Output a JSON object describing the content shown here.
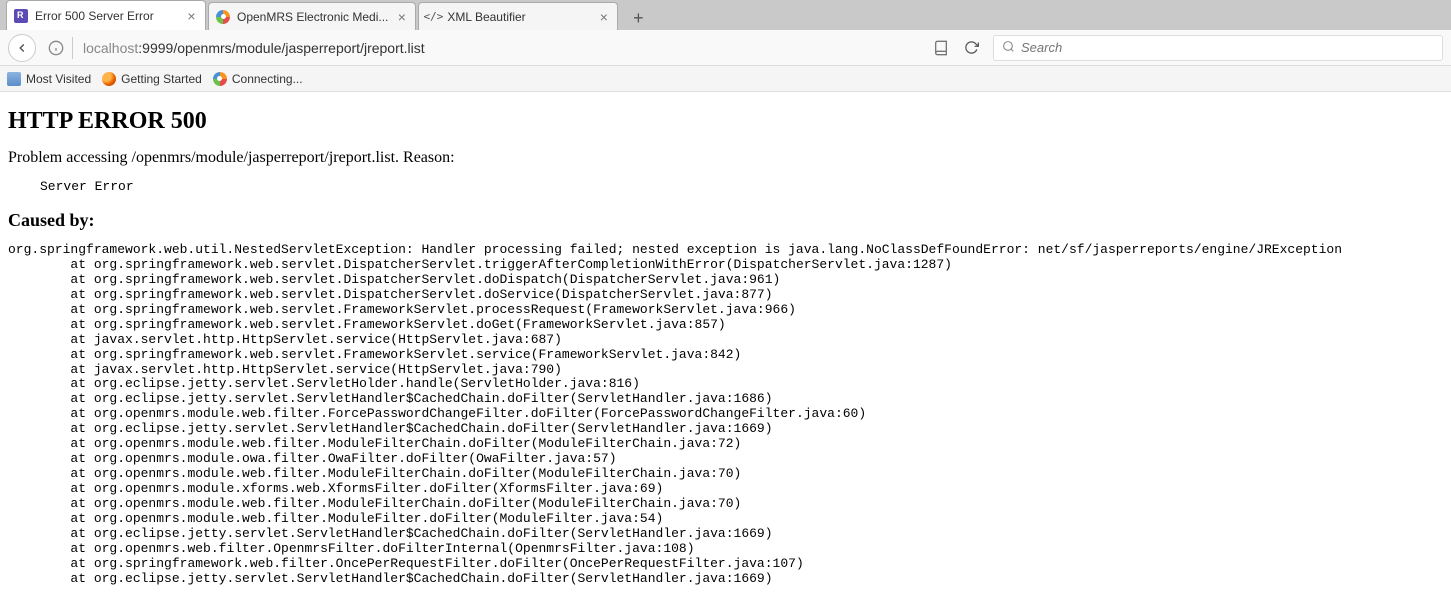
{
  "tabs": [
    {
      "title": "Error 500 Server Error",
      "active": true,
      "favicon": "jr"
    },
    {
      "title": "OpenMRS Electronic Medi...",
      "active": false,
      "favicon": "openmrs"
    },
    {
      "title": "XML Beautifier",
      "active": false,
      "favicon": "xml"
    }
  ],
  "url": {
    "hostPrefix": "localhost",
    "port": ":9999",
    "path": "/openmrs/module/jasperreport/jreport.list"
  },
  "search": {
    "placeholder": "Search"
  },
  "bookmarks": [
    {
      "label": "Most Visited",
      "icon": "most"
    },
    {
      "label": "Getting Started",
      "icon": "moz"
    },
    {
      "label": "Connecting...",
      "icon": "openmrs"
    }
  ],
  "error": {
    "heading": "HTTP ERROR 500",
    "problemPrefix": "Problem accessing ",
    "problemPath": "/openmrs/module/jasperreport/jreport.list",
    "problemSuffix": ". Reason:",
    "reason": "Server Error",
    "causedBy": "Caused by:",
    "trace": "org.springframework.web.util.NestedServletException: Handler processing failed; nested exception is java.lang.NoClassDefFoundError: net/sf/jasperreports/engine/JRException\n\tat org.springframework.web.servlet.DispatcherServlet.triggerAfterCompletionWithError(DispatcherServlet.java:1287)\n\tat org.springframework.web.servlet.DispatcherServlet.doDispatch(DispatcherServlet.java:961)\n\tat org.springframework.web.servlet.DispatcherServlet.doService(DispatcherServlet.java:877)\n\tat org.springframework.web.servlet.FrameworkServlet.processRequest(FrameworkServlet.java:966)\n\tat org.springframework.web.servlet.FrameworkServlet.doGet(FrameworkServlet.java:857)\n\tat javax.servlet.http.HttpServlet.service(HttpServlet.java:687)\n\tat org.springframework.web.servlet.FrameworkServlet.service(FrameworkServlet.java:842)\n\tat javax.servlet.http.HttpServlet.service(HttpServlet.java:790)\n\tat org.eclipse.jetty.servlet.ServletHolder.handle(ServletHolder.java:816)\n\tat org.eclipse.jetty.servlet.ServletHandler$CachedChain.doFilter(ServletHandler.java:1686)\n\tat org.openmrs.module.web.filter.ForcePasswordChangeFilter.doFilter(ForcePasswordChangeFilter.java:60)\n\tat org.eclipse.jetty.servlet.ServletHandler$CachedChain.doFilter(ServletHandler.java:1669)\n\tat org.openmrs.module.web.filter.ModuleFilterChain.doFilter(ModuleFilterChain.java:72)\n\tat org.openmrs.module.owa.filter.OwaFilter.doFilter(OwaFilter.java:57)\n\tat org.openmrs.module.web.filter.ModuleFilterChain.doFilter(ModuleFilterChain.java:70)\n\tat org.openmrs.module.xforms.web.XformsFilter.doFilter(XformsFilter.java:69)\n\tat org.openmrs.module.web.filter.ModuleFilterChain.doFilter(ModuleFilterChain.java:70)\n\tat org.openmrs.module.web.filter.ModuleFilter.doFilter(ModuleFilter.java:54)\n\tat org.eclipse.jetty.servlet.ServletHandler$CachedChain.doFilter(ServletHandler.java:1669)\n\tat org.openmrs.web.filter.OpenmrsFilter.doFilterInternal(OpenmrsFilter.java:108)\n\tat org.springframework.web.filter.OncePerRequestFilter.doFilter(OncePerRequestFilter.java:107)\n\tat org.eclipse.jetty.servlet.ServletHandler$CachedChain.doFilter(ServletHandler.java:1669)"
  }
}
